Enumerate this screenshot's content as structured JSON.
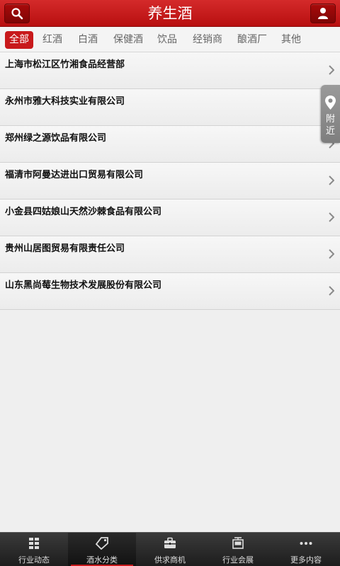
{
  "header": {
    "title": "养生酒",
    "search_icon": "search-icon",
    "user_icon": "user-icon"
  },
  "tabs": [
    {
      "label": "全部",
      "active": true
    },
    {
      "label": "红酒"
    },
    {
      "label": "白酒"
    },
    {
      "label": "保健酒"
    },
    {
      "label": "饮品"
    },
    {
      "label": "经销商"
    },
    {
      "label": "酿酒厂"
    },
    {
      "label": "其他"
    }
  ],
  "list": [
    {
      "name": "上海市松江区竹湘食品经营部"
    },
    {
      "name": "永州市雅大科技实业有限公司"
    },
    {
      "name": "郑州绿之源饮品有限公司"
    },
    {
      "name": "福清市阿曼达进出口贸易有限公司"
    },
    {
      "name": "小金县四姑娘山天然沙棘食品有限公司"
    },
    {
      "name": "贵州山居图贸易有限责任公司"
    },
    {
      "name": "山东黑尚莓生物技术发展股份有限公司"
    }
  ],
  "nearby": {
    "label_line1": "附",
    "label_line2": "近",
    "icon": "location-pin-icon"
  },
  "bottom_nav": [
    {
      "label": "行业动态",
      "icon": "news-grid-icon"
    },
    {
      "label": "酒水分类",
      "icon": "tag-icon",
      "active": true
    },
    {
      "label": "供求商机",
      "icon": "briefcase-icon"
    },
    {
      "label": "行业会展",
      "icon": "exhibition-icon"
    },
    {
      "label": "更多内容",
      "icon": "more-dots-icon"
    }
  ],
  "colors": {
    "accent": "#c8191b",
    "header": "#c11b1c"
  }
}
